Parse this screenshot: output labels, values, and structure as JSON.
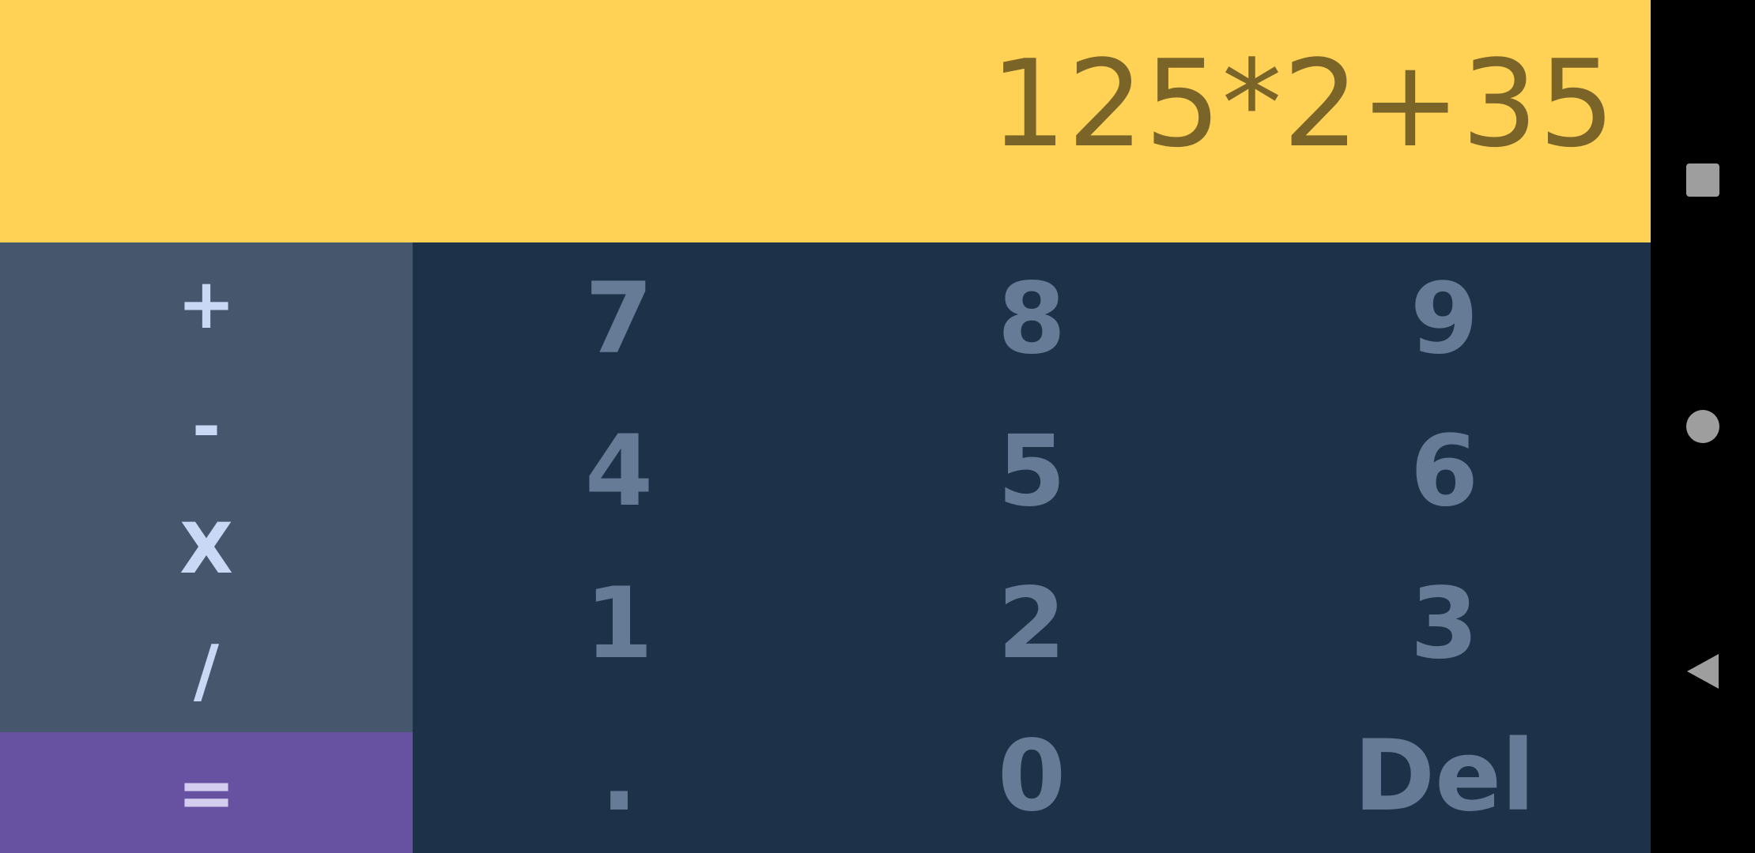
{
  "display": {
    "expression": "125*2+35"
  },
  "operators": [
    {
      "label": "+",
      "name": "plus-button"
    },
    {
      "label": "-",
      "name": "minus-button"
    },
    {
      "label": "X",
      "name": "multiply-button"
    },
    {
      "label": "/",
      "name": "divide-button"
    }
  ],
  "equals": {
    "label": "="
  },
  "keys": [
    {
      "label": "7"
    },
    {
      "label": "8"
    },
    {
      "label": "9"
    },
    {
      "label": "4"
    },
    {
      "label": "5"
    },
    {
      "label": "6"
    },
    {
      "label": "1"
    },
    {
      "label": "2"
    },
    {
      "label": "3"
    },
    {
      "label": "."
    },
    {
      "label": "0"
    },
    {
      "label": "Del"
    }
  ],
  "colors": {
    "display_bg": "#FFD255",
    "display_text": "#7A6428",
    "operators_bg": "#46566D",
    "equals_bg": "#6751A1",
    "keypad_bg": "#1D3148",
    "key_text": "#667B95"
  },
  "navbar": {
    "items": [
      {
        "icon": "recents-square-icon"
      },
      {
        "icon": "home-circle-icon"
      },
      {
        "icon": "back-triangle-icon"
      }
    ]
  }
}
